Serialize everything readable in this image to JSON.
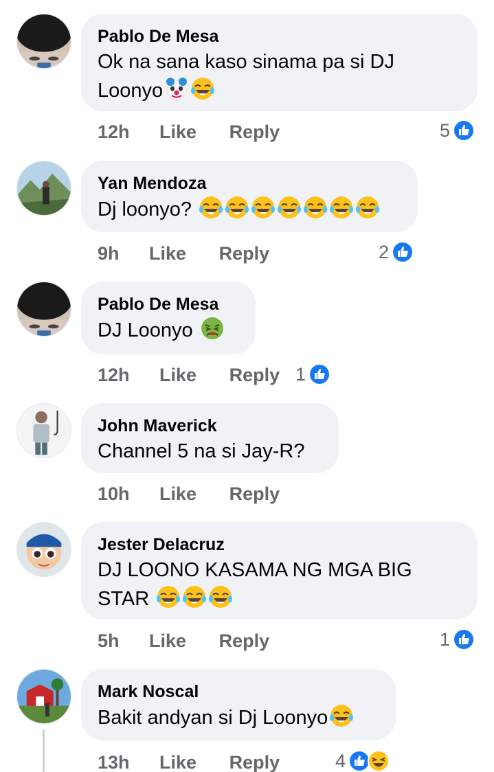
{
  "comments": [
    {
      "author": "Pablo De Mesa",
      "text": "Ok na sana kaso sinama pa si DJ",
      "text2": "Loonyo",
      "emojis": [
        "clown-face",
        "tears-of-joy"
      ],
      "time": "12h",
      "like_label": "Like",
      "reply_label": "Reply",
      "reaction_count": "5",
      "reactions": [
        "like"
      ]
    },
    {
      "author": "Yan Mendoza",
      "text": "Dj loonyo?",
      "emojis": [
        "tears-of-joy",
        "tears-of-joy",
        "tears-of-joy",
        "tears-of-joy",
        "tears-of-joy",
        "tears-of-joy",
        "tears-of-joy"
      ],
      "time": "9h",
      "like_label": "Like",
      "reply_label": "Reply",
      "reaction_count": "2",
      "reactions": [
        "like"
      ]
    },
    {
      "author": "Pablo De Mesa",
      "text": "DJ Loonyo",
      "emojis": [
        "nauseated-face"
      ],
      "time": "12h",
      "like_label": "Like",
      "reply_label": "Reply",
      "reaction_count": "1",
      "reactions": [
        "like"
      ]
    },
    {
      "author": "John Maverick",
      "text": "Channel 5 na si Jay-R?",
      "emojis": [],
      "time": "10h",
      "like_label": "Like",
      "reply_label": "Reply"
    },
    {
      "author": "Jester Delacruz",
      "text": "DJ LOONO KASAMA NG MGA BIG",
      "text2": "STAR",
      "emojis": [
        "tears-of-joy",
        "tears-of-joy",
        "tears-of-joy"
      ],
      "time": "5h",
      "like_label": "Like",
      "reply_label": "Reply",
      "reaction_count": "1",
      "reactions": [
        "like"
      ]
    },
    {
      "author": "Mark Noscal",
      "text": "Bakit andyan si Dj Loonyo",
      "emojis": [
        "tears-of-joy"
      ],
      "time": "13h",
      "like_label": "Like",
      "reply_label": "Reply",
      "reaction_count": "4",
      "reactions": [
        "like",
        "haha"
      ]
    }
  ],
  "colors": {
    "bubble": "#f0f2f5",
    "meta_text": "#65676b",
    "like_blue": "#1877f2",
    "emoji_yellow": "#fcc21b"
  }
}
